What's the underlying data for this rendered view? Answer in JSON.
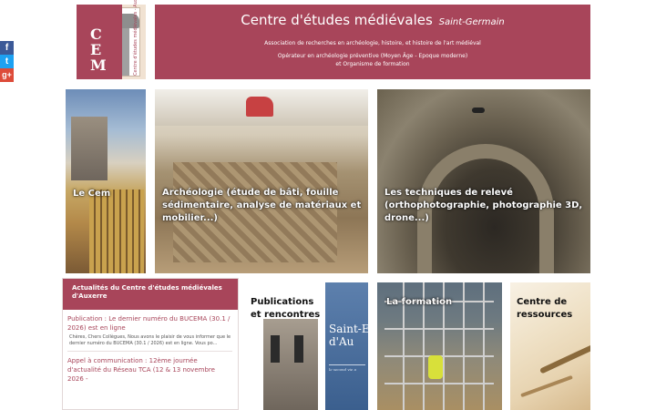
{
  "social": {
    "facebook_glyph": "f",
    "twitter_glyph": "t",
    "googleplus_glyph": "g+"
  },
  "logo": {
    "letters": "CEM",
    "side_text": "Centre d'études médiévales - Auxerre"
  },
  "header": {
    "title": "Centre d'études médiévales",
    "subtitle": "Saint-Germain",
    "line1": "Association de recherches en archéologie, histoire, et histoire de l'art médiéval",
    "line2": "Opérateur en archéologie préventive (Moyen Âge - Epoque moderne)",
    "line3": "et Organisme de formation"
  },
  "tiles": {
    "cem": "Le Cem",
    "archeo": "Archéologie (étude de bâti, fouille sédimentaire, analyse de matériaux et mobilier...)",
    "tech": "Les techniques de relevé (orthophotographie, photographie 3D, drone...)",
    "publications": "Publications et rencontres",
    "formation": "La formation",
    "ressources": "Centre de ressources"
  },
  "publications_cover": {
    "title": "Saint-E\nd'Au",
    "note": "le second vie a"
  },
  "news": {
    "heading": "Actualités du Centre d'études médiévales d'Auxerre",
    "items": [
      {
        "title": "Publication : Le dernier numéro du BUCEMA (30.1 / 2026) est en ligne",
        "excerpt": "Chères, Chers Collègues, Nous avons le plaisir de vous informer que le dernier numéro du BUCEMA (30.1 / 2026) est en ligne. Vous po..."
      },
      {
        "title": "Appel à communication : 12ème journée d'actualité du Réseau TCA (12 & 13 novembre 2026 -",
        "excerpt": ""
      }
    ]
  },
  "colors": {
    "brand": "#a8455a",
    "facebook": "#3b5998",
    "twitter": "#1da1f2",
    "googleplus": "#dd4b39"
  }
}
